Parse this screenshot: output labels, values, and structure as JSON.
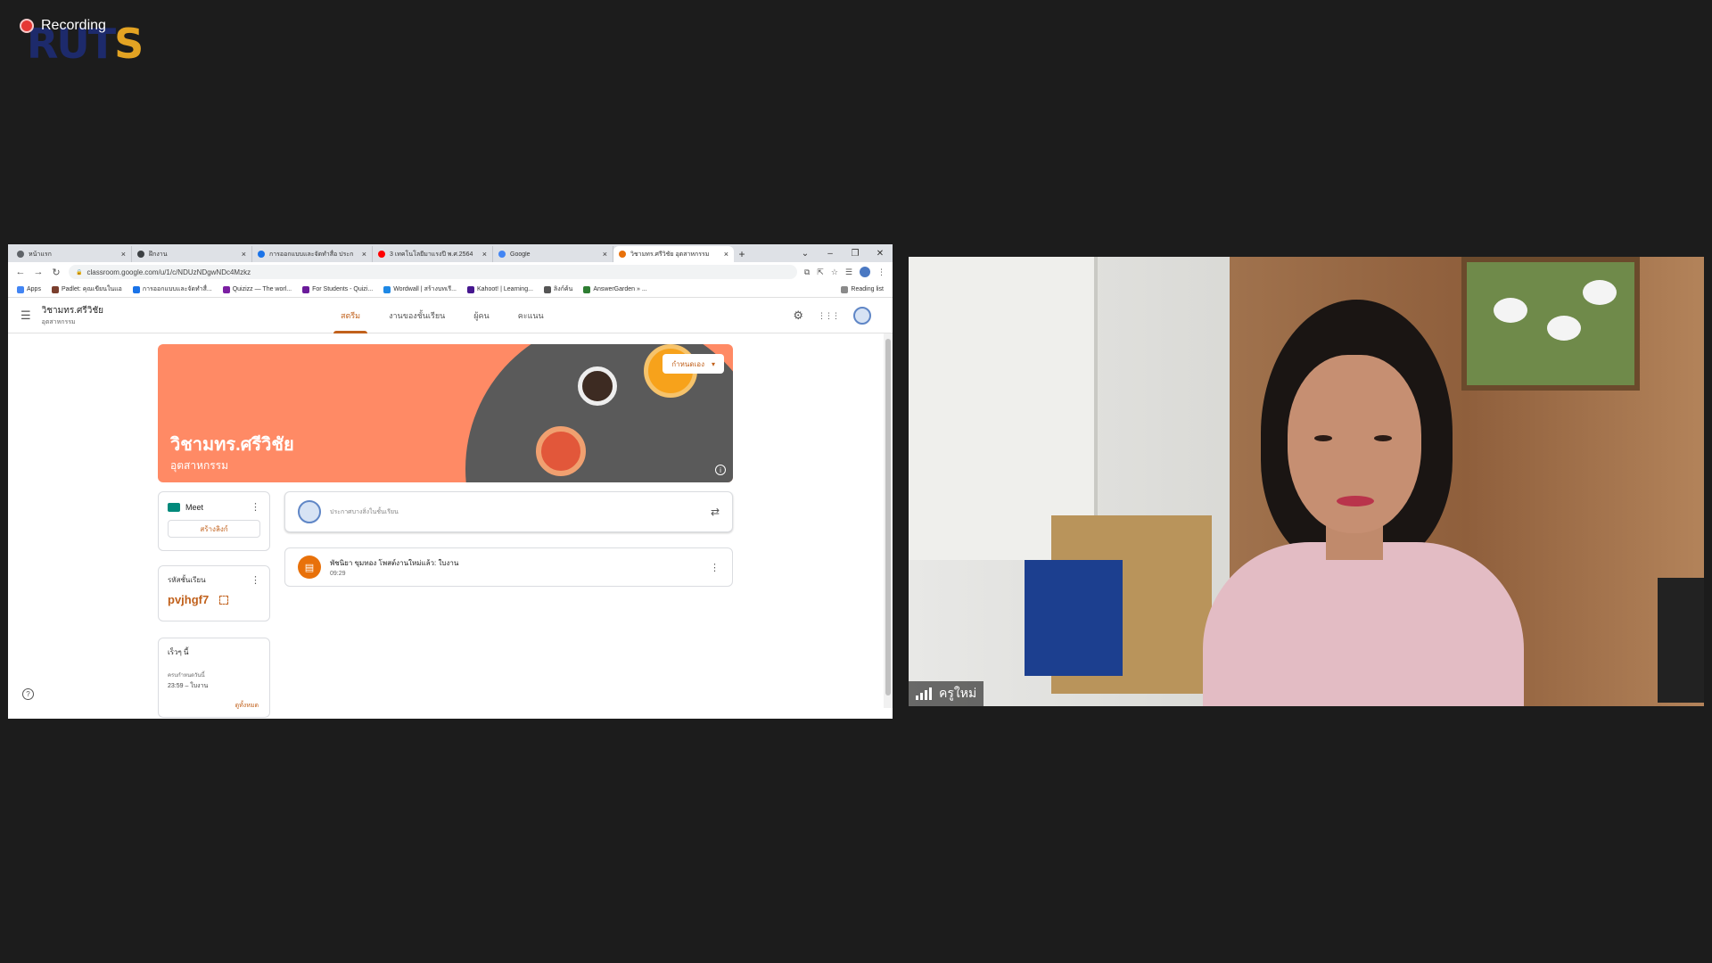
{
  "recording": {
    "label": "Recording"
  },
  "logo": {
    "main_left": "RUT",
    "main_right": "S"
  },
  "browser": {
    "tabs": [
      {
        "title": "หน้าแรก",
        "close": "×",
        "active": false,
        "color": "#5f6368"
      },
      {
        "title": "ฝึกงาน",
        "close": "×",
        "active": false,
        "color": "#3c4043"
      },
      {
        "title": "การออกแบบและจัดทำสื่อ ประก",
        "close": "×",
        "active": false,
        "color": "#1a73e8"
      },
      {
        "title": "3 เทคโนโลยีมาแรงปี พ.ศ.2564",
        "close": "×",
        "active": false,
        "color": "#ff0000"
      },
      {
        "title": "Google",
        "close": "×",
        "active": false,
        "color": "#4285f4"
      },
      {
        "title": "วิชามทร.ศรีวิชัย อุตสาหกรรม",
        "close": "×",
        "active": true,
        "color": "#e8710a"
      }
    ],
    "new_tab": "+",
    "window_controls": {
      "dropdown": "⌄",
      "minimize": "–",
      "restore": "❐",
      "close": "✕"
    },
    "nav": {
      "back": "←",
      "forward": "→",
      "reload": "↻"
    },
    "url": "classroom.google.com/u/1/c/NDUzNDgwNDc4Mzkz",
    "lock": "🔒",
    "addr_tools": {
      "translate": "⧉",
      "share": "⇱",
      "star": "☆",
      "reading": "☰",
      "menu": "⋮"
    },
    "bookmarks": [
      {
        "label": "Apps",
        "color": "#4285f4"
      },
      {
        "label": "Padlet: คุณเขียนในแอ",
        "color": "#7b3f2e"
      },
      {
        "label": "การออกแบบและจัดทำสื่...",
        "color": "#1a73e8"
      },
      {
        "label": "Quizizz — The worl...",
        "color": "#7b1fa2"
      },
      {
        "label": "For Students - Quizi...",
        "color": "#6a1b9a"
      },
      {
        "label": "Wordwall | สร้างบทเรี...",
        "color": "#1e88e5"
      },
      {
        "label": "Kahoot! | Learning...",
        "color": "#46178f"
      },
      {
        "label": "ลิงก์ค้น",
        "color": "#555555"
      },
      {
        "label": "AnswerGarden » ...",
        "color": "#2e7d32"
      }
    ],
    "reading_list": "Reading list"
  },
  "classroom": {
    "menu_icon": "☰",
    "class_name": "วิชามทร.ศรีวิชัย",
    "class_section": "อุตสาหกรรม",
    "tabs": [
      {
        "label": "สตรีม",
        "active": true
      },
      {
        "label": "งานของชั้นเรียน",
        "active": false
      },
      {
        "label": "ผู้คน",
        "active": false
      },
      {
        "label": "คะแนน",
        "active": false
      }
    ],
    "header_icons": {
      "settings": "⚙",
      "apps": "⋮⋮⋮"
    },
    "banner": {
      "title": "วิชามทร.ศรีวิชัย",
      "subtitle": "อุตสาหกรรม",
      "customize_label": "กำหนดเอง",
      "customize_caret": "▾",
      "info": "i",
      "color": "#ff8a65"
    },
    "meet": {
      "label": "Meet",
      "button": "สร้างลิงก์",
      "menu": "⋮"
    },
    "class_code": {
      "label": "รหัสชั้นเรียน",
      "value": "pvjhgf7",
      "menu": "⋮"
    },
    "upcoming": {
      "title": "เร็วๆ นี้",
      "due_label": "ครบกำหนดวันนี้",
      "item": "23:59 – ใบงาน",
      "link": "ดูทั้งหมด"
    },
    "announce": {
      "placeholder": "ประกาศบางสิ่งในชั้นเรียน",
      "repeat_icon": "⇄"
    },
    "post": {
      "icon": "▤",
      "title": "พัชนิยา ขุมทอง โพสต์งานใหม่แล้ว: ใบงาน",
      "time": "09:29",
      "menu": "⋮"
    },
    "help": "?",
    "accent_color": "#c1611c"
  },
  "video": {
    "name": "ครูใหม่"
  }
}
